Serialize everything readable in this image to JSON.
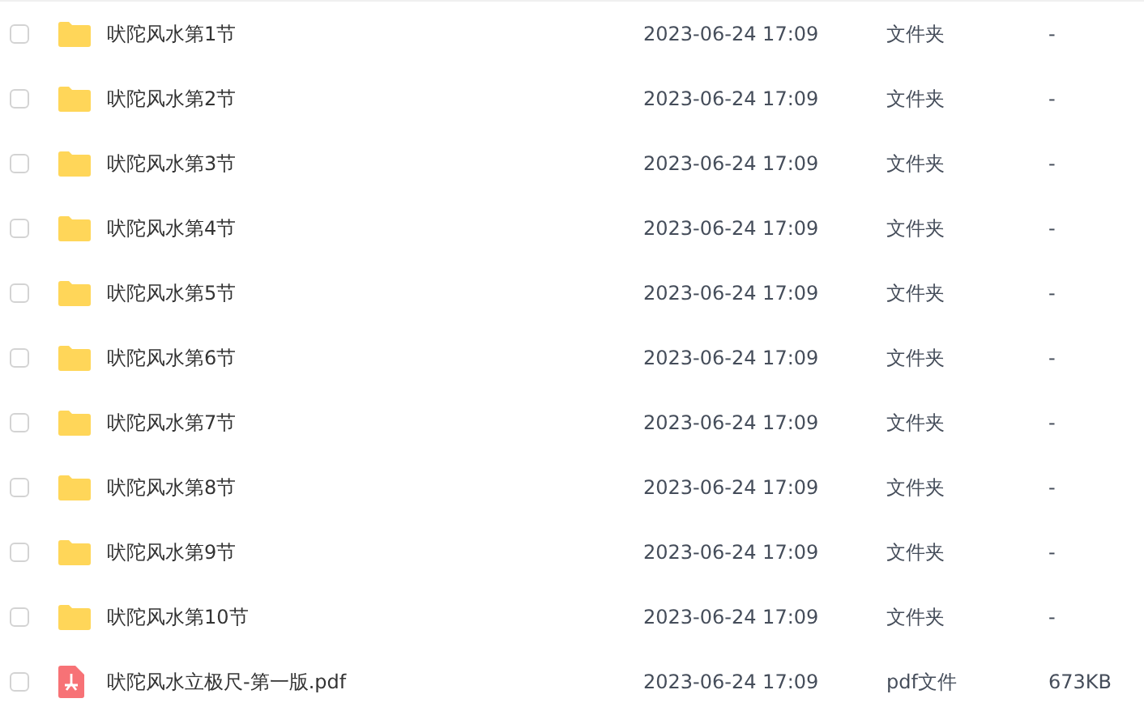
{
  "files": [
    {
      "kind": "folder",
      "checked": false,
      "name": "吠陀风水第1节",
      "modified": "2023-06-24 17:09",
      "type": "文件夹",
      "size": "-"
    },
    {
      "kind": "folder",
      "checked": false,
      "name": "吠陀风水第2节",
      "modified": "2023-06-24 17:09",
      "type": "文件夹",
      "size": "-"
    },
    {
      "kind": "folder",
      "checked": false,
      "name": "吠陀风水第3节",
      "modified": "2023-06-24 17:09",
      "type": "文件夹",
      "size": "-"
    },
    {
      "kind": "folder",
      "checked": false,
      "name": "吠陀风水第4节",
      "modified": "2023-06-24 17:09",
      "type": "文件夹",
      "size": "-"
    },
    {
      "kind": "folder",
      "checked": false,
      "name": "吠陀风水第5节",
      "modified": "2023-06-24 17:09",
      "type": "文件夹",
      "size": "-"
    },
    {
      "kind": "folder",
      "checked": false,
      "name": "吠陀风水第6节",
      "modified": "2023-06-24 17:09",
      "type": "文件夹",
      "size": "-"
    },
    {
      "kind": "folder",
      "checked": false,
      "name": "吠陀风水第7节",
      "modified": "2023-06-24 17:09",
      "type": "文件夹",
      "size": "-"
    },
    {
      "kind": "folder",
      "checked": false,
      "name": "吠陀风水第8节",
      "modified": "2023-06-24 17:09",
      "type": "文件夹",
      "size": "-"
    },
    {
      "kind": "folder",
      "checked": false,
      "name": "吠陀风水第9节",
      "modified": "2023-06-24 17:09",
      "type": "文件夹",
      "size": "-"
    },
    {
      "kind": "folder",
      "checked": false,
      "name": "吠陀风水第10节",
      "modified": "2023-06-24 17:09",
      "type": "文件夹",
      "size": "-"
    },
    {
      "kind": "pdf",
      "checked": false,
      "name": "吠陀风水立极尺-第一版.pdf",
      "modified": "2023-06-24 17:09",
      "type": "pdf文件",
      "size": "673KB"
    }
  ]
}
